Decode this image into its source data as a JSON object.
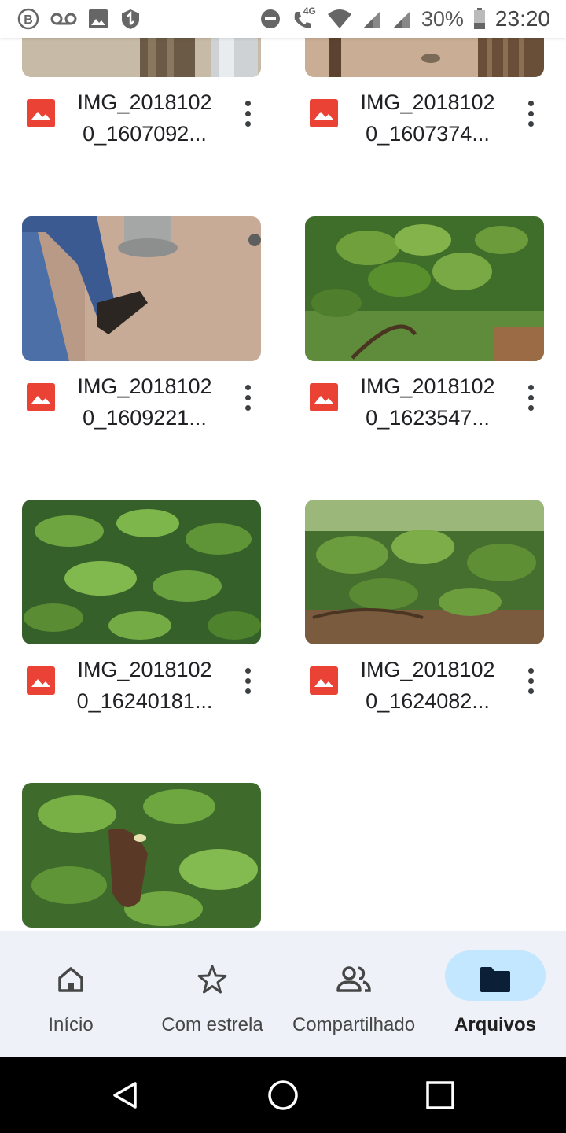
{
  "status_bar": {
    "left_icons": [
      "b-badge-icon",
      "voicemail-icon",
      "image-icon",
      "data-saver-icon"
    ],
    "right_icons": [
      "dnd-icon",
      "volte-4g-call-icon",
      "wifi-icon",
      "signal-icon",
      "signal-icon"
    ],
    "network_label": "4G",
    "battery": "30%",
    "time": "23:20"
  },
  "files": [
    {
      "name": "IMG_2018102\n0_1607092...",
      "photo": "floor-post"
    },
    {
      "name": "IMG_2018102\n0_1607374...",
      "photo": "floor-pen"
    },
    {
      "name": "IMG_2018102\n0_1609221...",
      "photo": "feet-feeder"
    },
    {
      "name": "IMG_2018102\n0_1623547...",
      "photo": "guava-tree"
    },
    {
      "name": "IMG_2018102\n0_16240181...",
      "photo": "guava-leaves"
    },
    {
      "name": "IMG_2018102\n0_1624082...",
      "photo": "guava-orchard"
    },
    {
      "name": "",
      "photo": "guava-hand"
    }
  ],
  "bottom_nav": {
    "items": [
      {
        "label": "Início",
        "icon": "home-icon",
        "active": false
      },
      {
        "label": "Com estrela",
        "icon": "star-icon",
        "active": false
      },
      {
        "label": "Compartilhado",
        "icon": "people-icon",
        "active": false
      },
      {
        "label": "Arquivos",
        "icon": "folder-icon",
        "active": true
      }
    ]
  },
  "colors": {
    "accent_pill": "#c2e7ff",
    "nav_background": "#eef2f8",
    "image_icon_red": "#ea4335"
  },
  "system_nav": [
    "back-icon",
    "home-circle-icon",
    "recents-icon"
  ]
}
